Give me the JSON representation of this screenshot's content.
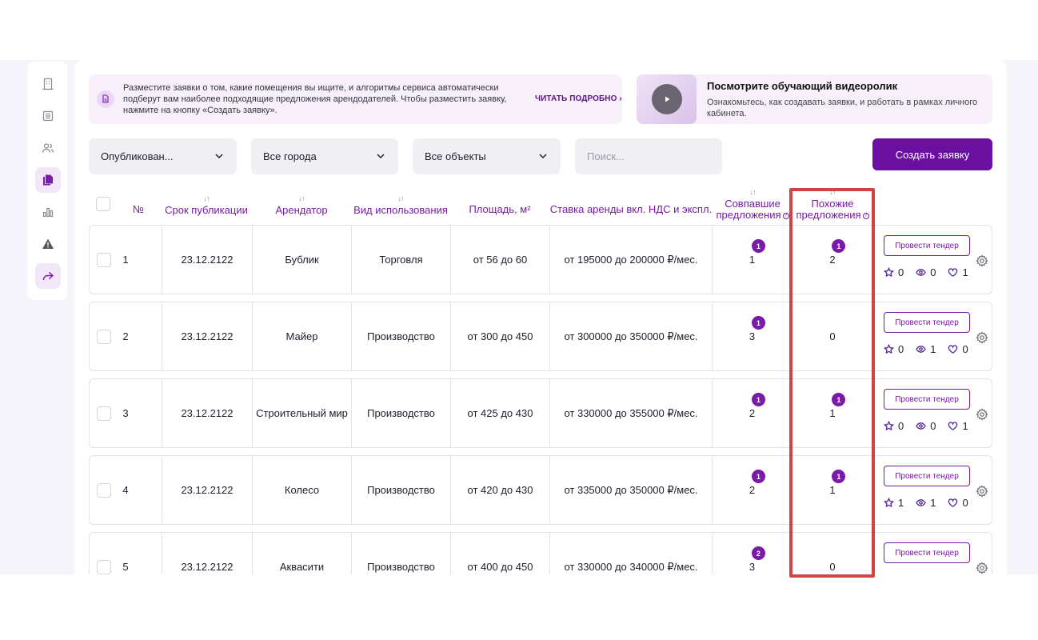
{
  "info": {
    "text": "Разместите заявки о том, какие помещения вы ищите, и алгоритмы сервиса автоматически подберут вам наиболее подходящие предложения арендодателей. Чтобы разместить заявку, нажмите на кнопку «Создать заявку».",
    "link": "ЧИТАТЬ ПОДРОБНО ›"
  },
  "video": {
    "title": "Посмотрите обучающий видеоролик",
    "desc": "Ознакомьтесь, как создавать заявки, и работать в рамках личного кабинета."
  },
  "filters": {
    "status": "Опубликован...",
    "city": "Все города",
    "objects": "Все объекты",
    "search_placeholder": "Поиск...",
    "create_label": "Создать заявку"
  },
  "headers": {
    "num": "№",
    "period": "Срок публикации",
    "tenant": "Арендатор",
    "usage": "Вид использования",
    "area": "Площадь, м²",
    "rate": "Ставка аренды вкл. НДС и экспл.",
    "matched": "Совпавшие предложения",
    "similar": "Похожие предложения",
    "sort_arrow": "↓↑",
    "help": "?"
  },
  "tender_label": "Провести тендер",
  "rows": [
    {
      "num": "1",
      "date": "23.12.2122",
      "tenant": "Бублик",
      "usage": "Торговля",
      "area": "от 56 до 60",
      "rate": "от 195000 до 200000 ₽/мес.",
      "matched": "1",
      "matched_badge": "1",
      "similar": "2",
      "similar_badge": "1",
      "stars": "0",
      "views": "0",
      "likes": "1"
    },
    {
      "num": "2",
      "date": "23.12.2122",
      "tenant": "Майер",
      "usage": "Производство",
      "area": "от 300 до 450",
      "rate": "от 300000 до 350000 ₽/мес.",
      "matched": "3",
      "matched_badge": "1",
      "similar": "0",
      "similar_badge": "",
      "stars": "0",
      "views": "1",
      "likes": "0"
    },
    {
      "num": "3",
      "date": "23.12.2122",
      "tenant": "Строительный мир",
      "usage": "Производство",
      "area": "от 425 до 430",
      "rate": "от 330000 до 355000 ₽/мес.",
      "matched": "2",
      "matched_badge": "1",
      "similar": "1",
      "similar_badge": "1",
      "stars": "0",
      "views": "0",
      "likes": "1"
    },
    {
      "num": "4",
      "date": "23.12.2122",
      "tenant": "Колесо",
      "usage": "Производство",
      "area": "от 420 до 430",
      "rate": "от 335000 до 350000 ₽/мес.",
      "matched": "2",
      "matched_badge": "1",
      "similar": "1",
      "similar_badge": "1",
      "stars": "1",
      "views": "1",
      "likes": "0"
    },
    {
      "num": "5",
      "date": "23.12.2122",
      "tenant": "Аквасити",
      "usage": "Производство",
      "area": "от 400 до 450",
      "rate": "от 330000 до 340000 ₽/мес.",
      "matched": "3",
      "matched_badge": "2",
      "similar": "0",
      "similar_badge": "",
      "stars": "",
      "views": "",
      "likes": ""
    }
  ],
  "colors": {
    "accent": "#7a1aa8",
    "button": "#6a0fa0",
    "highlight": "#d0453f"
  }
}
